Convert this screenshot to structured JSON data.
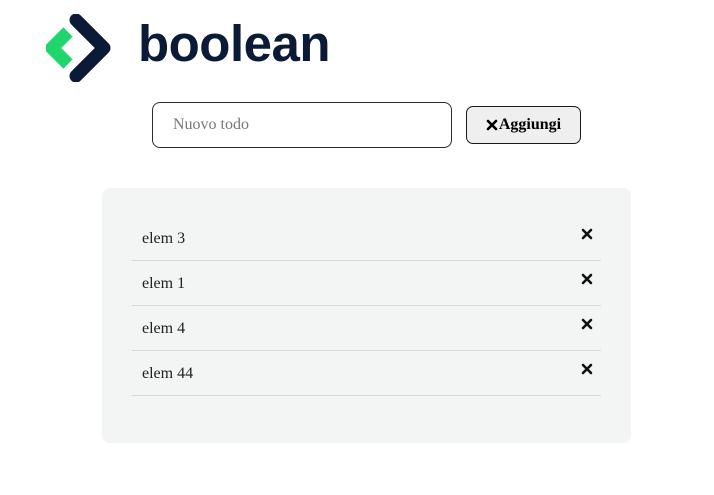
{
  "brand": {
    "name": "boolean",
    "logo_icon": "chevron-brackets-icon",
    "colors": {
      "dark": "#0b1a36",
      "accent": "#1fd66c"
    }
  },
  "form": {
    "input_value": "",
    "input_placeholder": "Nuovo todo",
    "add_label": "Aggiungi",
    "add_icon": "close-icon"
  },
  "todos": [
    {
      "text": "elem 3",
      "delete_icon": "close-icon"
    },
    {
      "text": "elem 1",
      "delete_icon": "close-icon"
    },
    {
      "text": "elem 4",
      "delete_icon": "close-icon"
    },
    {
      "text": "elem 44",
      "delete_icon": "close-icon"
    }
  ]
}
